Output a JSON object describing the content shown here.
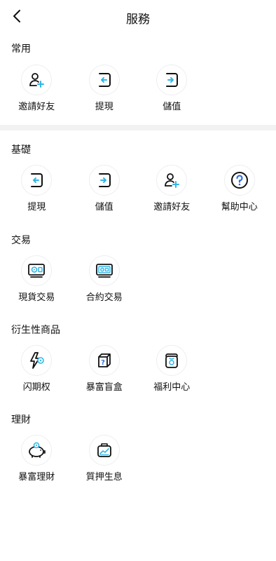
{
  "header": {
    "title": "服務"
  },
  "sections": [
    {
      "title": "常用",
      "items": [
        {
          "label": "邀請好友",
          "icon": "add-user-icon"
        },
        {
          "label": "提現",
          "icon": "withdraw-icon"
        },
        {
          "label": "儲值",
          "icon": "deposit-icon"
        }
      ]
    },
    {
      "title": "基礎",
      "items": [
        {
          "label": "提現",
          "icon": "withdraw-icon"
        },
        {
          "label": "儲值",
          "icon": "deposit-icon"
        },
        {
          "label": "邀請好友",
          "icon": "add-user-icon"
        },
        {
          "label": "幫助中心",
          "icon": "help-icon"
        }
      ]
    },
    {
      "title": "交易",
      "items": [
        {
          "label": "現貨交易",
          "icon": "safe-icon"
        },
        {
          "label": "合約交易",
          "icon": "contract-icon"
        }
      ]
    },
    {
      "title": "衍生性商品",
      "items": [
        {
          "label": "闪期权",
          "icon": "lightning-icon"
        },
        {
          "label": "暴富盲盒",
          "icon": "mystery-box-icon"
        },
        {
          "label": "福利中心",
          "icon": "gift-bag-icon"
        }
      ]
    },
    {
      "title": "理財",
      "items": [
        {
          "label": "暴富理財",
          "icon": "piggy-bank-icon"
        },
        {
          "label": "質押生息",
          "icon": "chart-bag-icon"
        }
      ]
    }
  ],
  "colors": {
    "accent": "#2fb6e6",
    "ink": "#111111",
    "divider": "#f2f2f3"
  }
}
